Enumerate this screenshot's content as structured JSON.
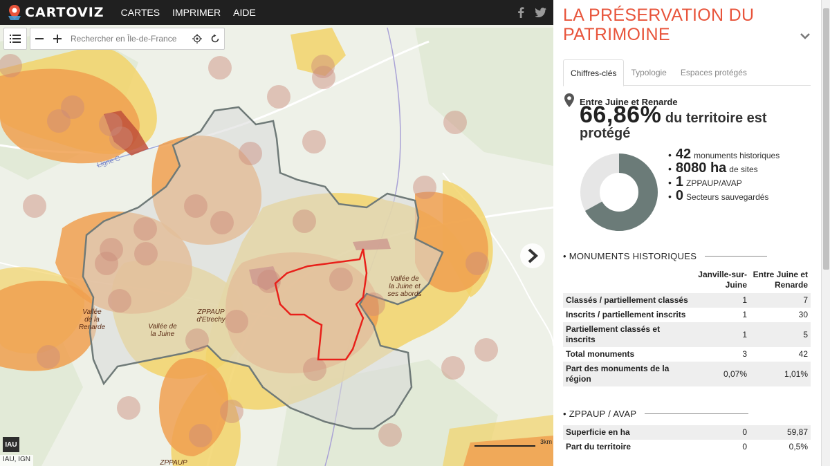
{
  "topbar": {
    "logo_text": "CARTOVIZ",
    "nav": [
      "CARTES",
      "IMPRIMER",
      "AIDE"
    ],
    "social_icons": [
      "facebook-icon",
      "twitter-icon"
    ]
  },
  "map": {
    "search_placeholder": "Rechercher en Île-de-France",
    "labels": {
      "ligne_c": "Ligne C",
      "vallee_renarde": "Vallée\nde la\nRenarde",
      "vallee_juine": "Vallée de\nla Juine",
      "zppaup_etrechy": "ZPPAUP\nd'Etrechy",
      "vallee_juine_abords": "Vallée de\nla Juine et\nses abords",
      "zppaup_bottom": "ZPPAUP"
    },
    "attribution": "IAU, IGN",
    "iau_logo": "IAU",
    "scale_label": "3km",
    "colors": {
      "protected_orange": "#f0a050",
      "protected_yellow": "#f2d36a",
      "monument_circle": "#c98a7a",
      "outline_grey": "#6f7a78",
      "selected_red": "#e8201a"
    }
  },
  "panel": {
    "title": "LA PRÉSERVATION DU PATRIMOINE",
    "tabs": [
      "Chiffres-clés",
      "Typologie",
      "Espaces protégés"
    ],
    "place": "Entre Juine et Renarde",
    "headline_pct": "66,86%",
    "headline_rest": " du territoire est protégé",
    "protected_share": 0.6686,
    "donut_colors": {
      "protected": "#6b7b78",
      "rest": "#e6e6e6"
    },
    "stats": [
      {
        "num": "42",
        "label": "monuments historiques"
      },
      {
        "num": "8080 ha",
        "label": "de sites"
      },
      {
        "num": "1",
        "label": "ZPPAUP/AVAP"
      },
      {
        "num": "0",
        "label": "Secteurs sauvegardés"
      }
    ],
    "monuments": {
      "heading": "MONUMENTS HISTORIQUES",
      "col1": "Janville-sur-Juine",
      "col2": "Entre Juine et Renarde",
      "rows": [
        {
          "label": "Classés / partiellement classés",
          "a": "1",
          "b": "7"
        },
        {
          "label": "Inscrits / partiellement inscrits",
          "a": "1",
          "b": "30"
        },
        {
          "label": "Partiellement classés et inscrits",
          "a": "1",
          "b": "5"
        },
        {
          "label": "Total monuments",
          "a": "3",
          "b": "42"
        },
        {
          "label": "Part des monuments de la région",
          "a": "0,07%",
          "b": "1,01%"
        }
      ]
    },
    "zppaup": {
      "heading": "ZPPAUP / AVAP",
      "rows": [
        {
          "label": "Superficie en ha",
          "a": "0",
          "b": "59,87"
        },
        {
          "label": "Part du territoire",
          "a": "0",
          "b": "0,5%"
        }
      ]
    }
  }
}
